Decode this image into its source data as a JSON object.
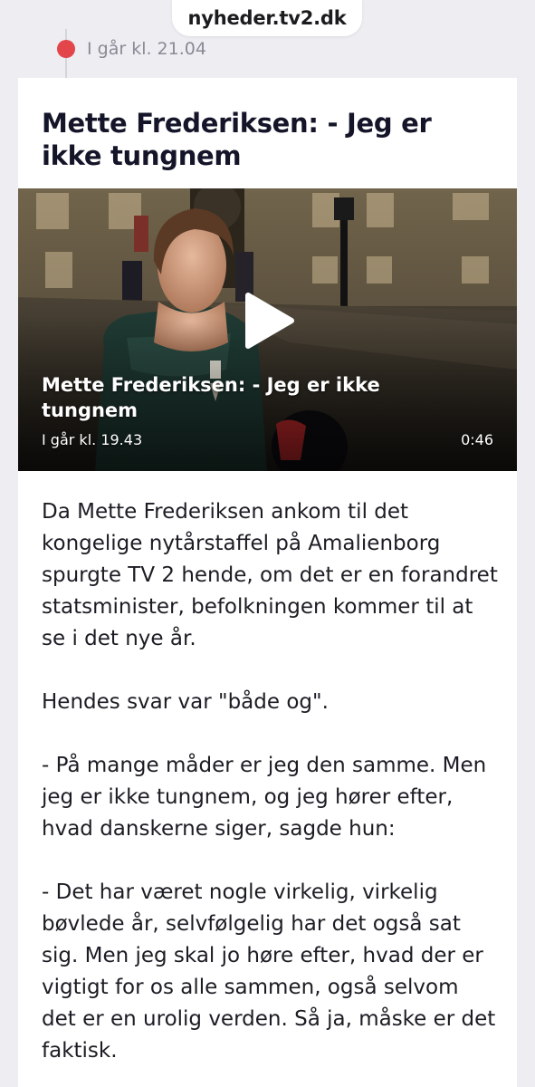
{
  "browser": {
    "url": "nyheder.tv2.dk"
  },
  "timeline": {
    "timestamp": "I går kl. 21.04",
    "dot_color": "#e2454a"
  },
  "article": {
    "headline": "Mette Frederiksen: - Jeg er ikke tungnem",
    "video": {
      "title": "Mette Frederiksen: - Jeg er ikke tungnem",
      "timestamp": "I går kl. 19.43",
      "duration": "0:46",
      "play_icon": "play-icon"
    },
    "paragraphs": [
      "Da Mette Frederiksen ankom til det kongelige nytårstaffel på Amalienborg spurgte TV 2 hende, om det er en forandret statsminister, befolkningen kommer til at se i det nye år.",
      "Hendes svar var \"både og\".",
      "- På mange måder er jeg den samme. Men jeg er ikke tungnem, og jeg hører efter, hvad danskerne siger, sagde hun:",
      "- Det har været nogle virkelig, virkelig bøvlede år, selvfølgelig har det også sat sig. Men jeg skal jo høre efter, hvad der er vigtigt for os alle sammen, også selvom det er en urolig verden. Så ja, måske er det faktisk."
    ]
  }
}
